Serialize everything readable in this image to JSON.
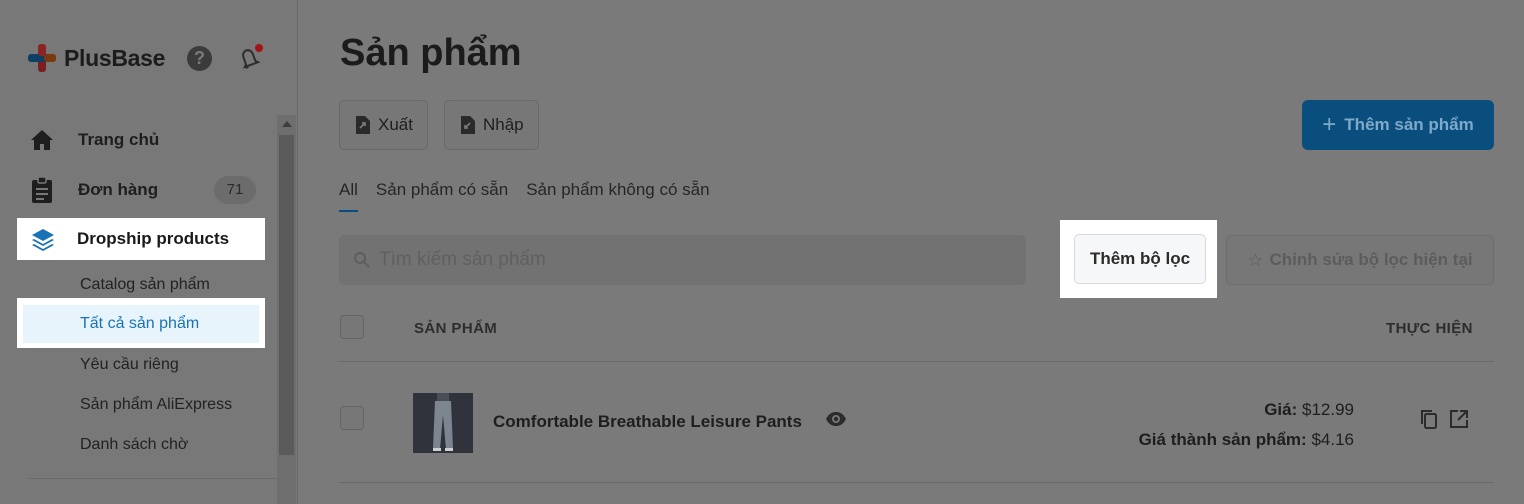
{
  "brand": {
    "name": "PlusBase"
  },
  "sidebar": {
    "items": [
      {
        "label": "Trang chủ",
        "icon": "home-icon"
      },
      {
        "label": "Đơn hàng",
        "icon": "clipboard-icon",
        "badge": "71"
      }
    ],
    "active_group": {
      "label": "Dropship products",
      "icon": "layers-icon"
    },
    "sub_items": [
      "Catalog sản phẩm",
      "Tất cả sản phẩm",
      "Yêu cầu riêng",
      "Sản phẩm AliExpress",
      "Danh sách chờ"
    ]
  },
  "header": {
    "title": "Sản phẩm",
    "export_label": "Xuất",
    "import_label": "Nhập",
    "add_product_label": "Thêm sản phẩm"
  },
  "tabs": [
    "All",
    "Sản phẩm có sẵn",
    "Sản phẩm không có sẵn"
  ],
  "search": {
    "placeholder": "Tìm kiếm sản phẩm"
  },
  "filters": {
    "add_filter_label": "Thêm bộ lọc",
    "edit_filter_label": "Chỉnh sửa bộ lọc hiện tại"
  },
  "table": {
    "columns": [
      "SẢN PHẨM",
      "THỰC HIỆN"
    ],
    "rows": [
      {
        "name": "Comfortable Breathable Leisure Pants",
        "price_label": "Giá:",
        "price": "$12.99",
        "cost_label": "Giá thành sản phẩm:",
        "cost": "$4.16"
      }
    ]
  },
  "colors": {
    "primary": "#0a4e7e",
    "link_active": "#1a73b5",
    "notification": "#a31515"
  }
}
